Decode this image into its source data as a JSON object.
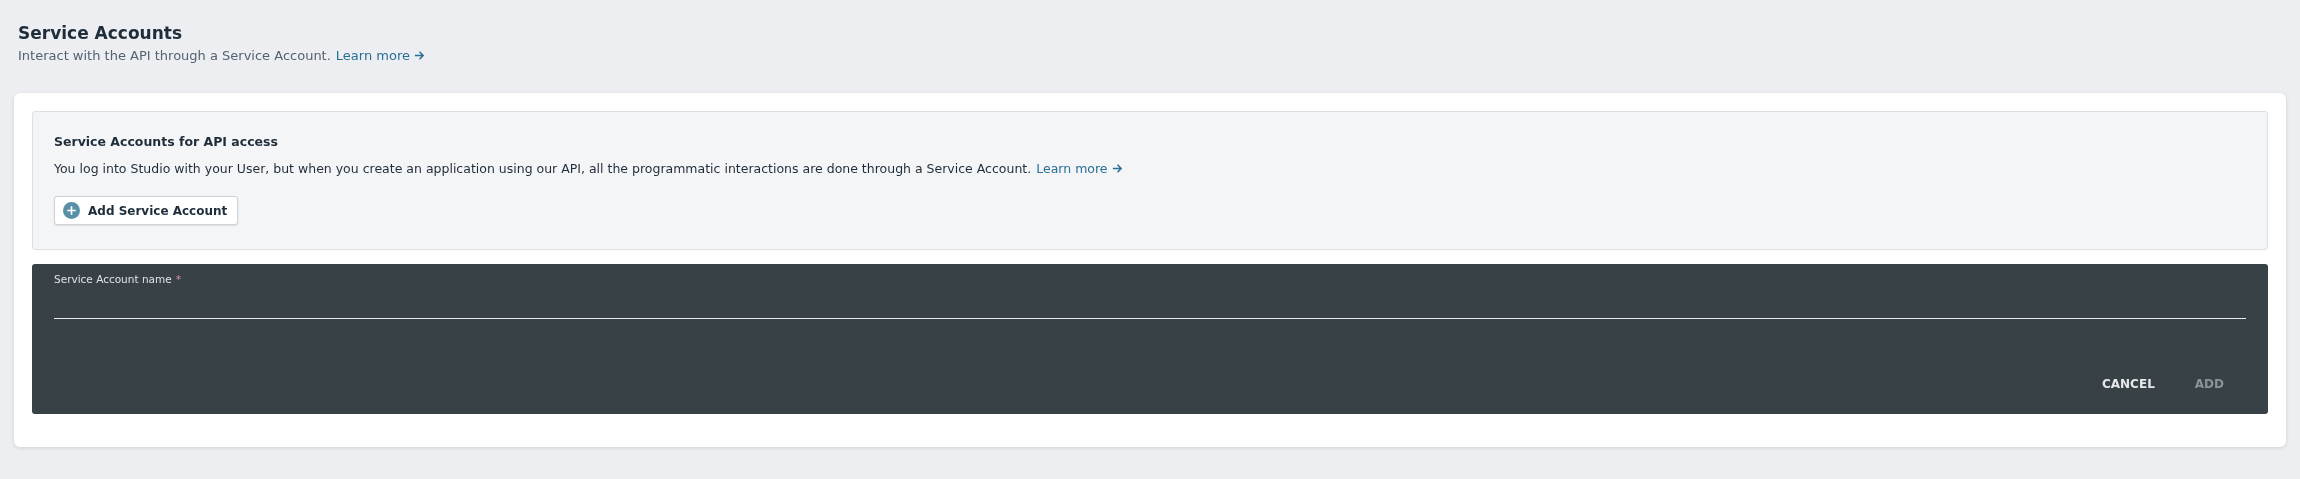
{
  "header": {
    "title": "Service Accounts",
    "subtitle": "Interact with the API through a Service Account.",
    "link": "Learn more"
  },
  "info_panel": {
    "title": "Service Accounts for API access",
    "text": "You log into Studio with your User, but when you create an application using our API, all the programmatic interactions are done through a Service Account.",
    "link": "Learn more",
    "button": "Add Service Account"
  },
  "form": {
    "label": "Service Account name",
    "required_mark": "*",
    "buttons": [
      {
        "label": "CANCEL",
        "disabled": false
      },
      {
        "label": "ADD",
        "disabled": true
      }
    ]
  }
}
